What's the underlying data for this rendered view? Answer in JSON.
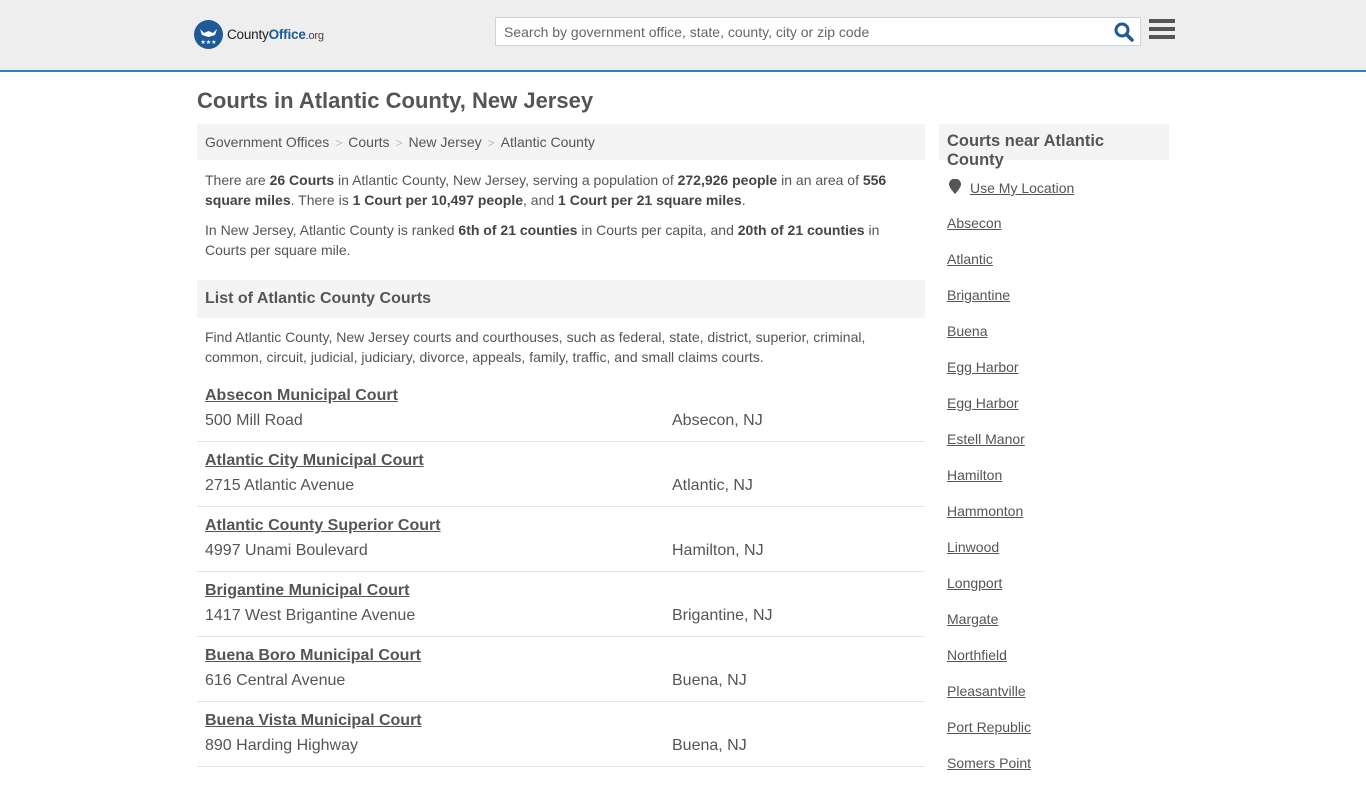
{
  "header": {
    "logo": {
      "name_part1": "County",
      "name_part2": "Office",
      "tld": ".org"
    },
    "search": {
      "placeholder": "Search by government office, state, county, city or zip code",
      "value": ""
    },
    "icons": {
      "search": "search-icon",
      "menu": "hamburger-menu-icon"
    }
  },
  "page": {
    "title": "Courts in Atlantic County, New Jersey"
  },
  "breadcrumb": [
    {
      "label": "Government Offices"
    },
    {
      "label": "Courts"
    },
    {
      "label": "New Jersey"
    },
    {
      "label": "Atlantic County"
    }
  ],
  "breadcrumb_separator": ">",
  "intro": {
    "p1": {
      "t1": "There are ",
      "b1": "26 Courts",
      "t2": " in Atlantic County, New Jersey, serving a population of ",
      "b2": "272,926 people",
      "t3": " in an area of ",
      "b3": "556 square miles",
      "t4": ". There is ",
      "b4": "1 Court per 10,497 people",
      "t5": ", and ",
      "b5": "1 Court per 21 square miles",
      "t6": "."
    },
    "p2": {
      "t1": "In New Jersey, Atlantic County is ranked ",
      "b1": "6th of 21 counties",
      "t2": " in Courts per capita, and ",
      "b2": "20th of 21 counties",
      "t3": " in Courts per square mile."
    }
  },
  "list_section": {
    "title": "List of Atlantic County Courts",
    "description": "Find Atlantic County, New Jersey courts and courthouses, such as federal, state, district, superior, criminal, common, circuit, judicial, judiciary, divorce, appeals, family, traffic, and small claims courts."
  },
  "courts": [
    {
      "name": "Absecon Municipal Court",
      "address": "500 Mill Road",
      "city": "Absecon, NJ"
    },
    {
      "name": "Atlantic City Municipal Court",
      "address": "2715 Atlantic Avenue",
      "city": "Atlantic, NJ"
    },
    {
      "name": "Atlantic County Superior Court",
      "address": "4997 Unami Boulevard",
      "city": "Hamilton, NJ"
    },
    {
      "name": "Brigantine Municipal Court",
      "address": "1417 West Brigantine Avenue",
      "city": "Brigantine, NJ"
    },
    {
      "name": "Buena Boro Municipal Court",
      "address": "616 Central Avenue",
      "city": "Buena, NJ"
    },
    {
      "name": "Buena Vista Municipal Court",
      "address": "890 Harding Highway",
      "city": "Buena, NJ"
    }
  ],
  "sidebar": {
    "title": "Courts near Atlantic County",
    "use_location": "Use My Location",
    "cities": [
      "Absecon",
      "Atlantic",
      "Brigantine",
      "Buena",
      "Egg Harbor",
      "Egg Harbor",
      "Estell Manor",
      "Hamilton",
      "Hammonton",
      "Linwood",
      "Longport",
      "Margate",
      "Northfield",
      "Pleasantville",
      "Port Republic",
      "Somers Point"
    ]
  },
  "colors": {
    "brand_blue": "#1e5a96",
    "header_border": "#3a7ab5",
    "header_bg": "#eeeeee",
    "panel_bg": "#f4f4f4",
    "text": "#555555"
  }
}
